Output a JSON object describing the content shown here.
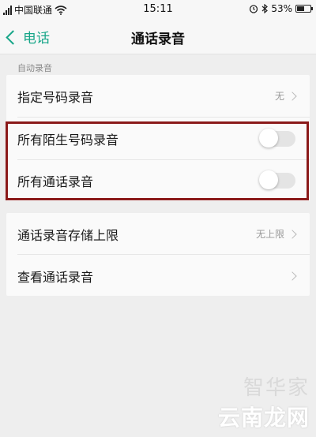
{
  "status_bar": {
    "carrier": "中国联通",
    "time": "15:11",
    "battery": "53%",
    "battery_level": 0.53
  },
  "nav": {
    "back_label": "电话",
    "title": "通话录音"
  },
  "sections": [
    {
      "header": "自动录音",
      "rows": [
        {
          "label": "指定号码录音",
          "value": "无",
          "type": "link"
        },
        {
          "label": "所有陌生号码录音",
          "type": "toggle",
          "on": false
        },
        {
          "label": "所有通话录音",
          "type": "toggle",
          "on": false
        }
      ]
    },
    {
      "rows": [
        {
          "label": "通话录音存储上限",
          "value": "无上限",
          "type": "link"
        },
        {
          "label": "查看通话录音",
          "type": "link"
        }
      ]
    }
  ],
  "watermark": {
    "top": "智华家",
    "bottom": "云南龙网"
  },
  "colors": {
    "accent": "#18a689",
    "highlight_border": "#8b1a1a"
  }
}
